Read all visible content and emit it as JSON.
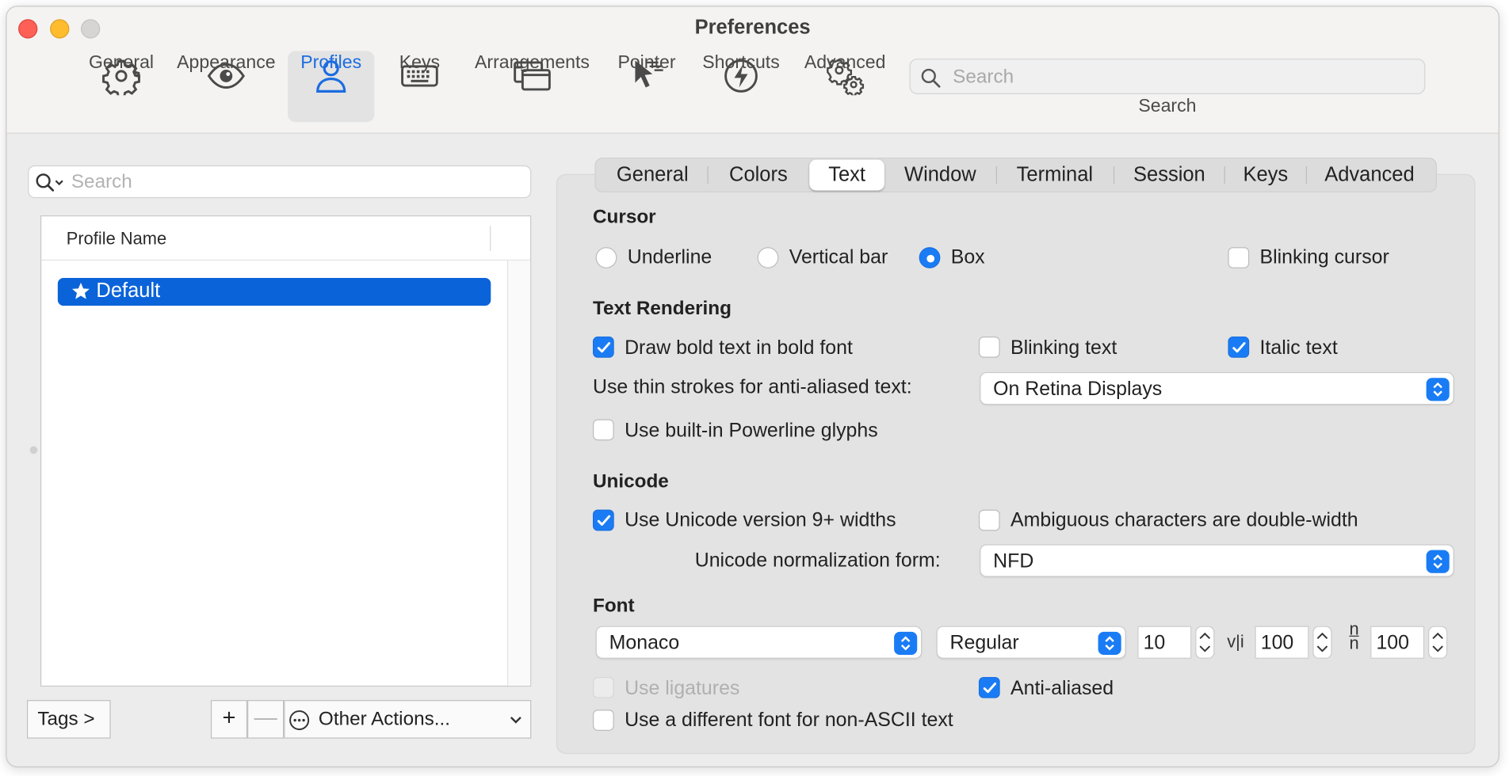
{
  "window": {
    "title": "Preferences"
  },
  "toolbar": {
    "items": [
      {
        "label": "General",
        "icon": "gear-icon"
      },
      {
        "label": "Appearance",
        "icon": "eye-icon"
      },
      {
        "label": "Profiles",
        "icon": "person-icon",
        "selected": true
      },
      {
        "label": "Keys",
        "icon": "keyboard-icon"
      },
      {
        "label": "Arrangements",
        "icon": "windows-icon"
      },
      {
        "label": "Pointer",
        "icon": "pointer-icon"
      },
      {
        "label": "Shortcuts",
        "icon": "lightning-icon"
      },
      {
        "label": "Advanced",
        "icon": "gears-icon"
      }
    ],
    "search": {
      "placeholder": "Search",
      "caption": "Search"
    }
  },
  "profiles": {
    "search_placeholder": "Search",
    "column_header": "Profile Name",
    "rows": [
      {
        "name": "Default",
        "default": true
      }
    ],
    "tags_button": "Tags >",
    "add_button": "+",
    "remove_button": "—",
    "other_actions": "Other Actions..."
  },
  "tabs": [
    "General",
    "Colors",
    "Text",
    "Window",
    "Terminal",
    "Session",
    "Keys",
    "Advanced"
  ],
  "active_tab": "Text",
  "cursor": {
    "heading": "Cursor",
    "options": [
      "Underline",
      "Vertical bar",
      "Box"
    ],
    "selected": "Box",
    "blinking_label": "Blinking cursor",
    "blinking": false
  },
  "text_rendering": {
    "heading": "Text Rendering",
    "bold_font_label": "Draw bold text in bold font",
    "bold_font": true,
    "blinking_text_label": "Blinking text",
    "blinking_text": false,
    "italic_text_label": "Italic text",
    "italic_text": true,
    "thin_strokes_label": "Use thin strokes for anti-aliased text:",
    "thin_strokes_value": "On Retina Displays",
    "powerline_label": "Use built-in Powerline glyphs",
    "powerline": false
  },
  "unicode": {
    "heading": "Unicode",
    "v9_label": "Use Unicode version 9+ widths",
    "v9": true,
    "ambiguous_label": "Ambiguous characters are double-width",
    "ambiguous": false,
    "normalization_label": "Unicode normalization form:",
    "normalization_value": "NFD"
  },
  "font": {
    "heading": "Font",
    "family": "Monaco",
    "style": "Regular",
    "size": "10",
    "h_spacing_glyph": "v|i",
    "h_spacing": "100",
    "v_spacing_glyph_top": "n",
    "v_spacing_glyph_bottom": "n",
    "v_spacing": "100",
    "ligatures_label": "Use ligatures",
    "ligatures": false,
    "antialiased_label": "Anti-aliased",
    "antialiased": true,
    "non_ascii_label": "Use a different font for non-ASCII text",
    "non_ascii": false
  },
  "colors": {
    "accent": "#1a7cf5",
    "selection": "#0a63d9",
    "close": "#fe5f57",
    "minimize": "#febc2e"
  }
}
